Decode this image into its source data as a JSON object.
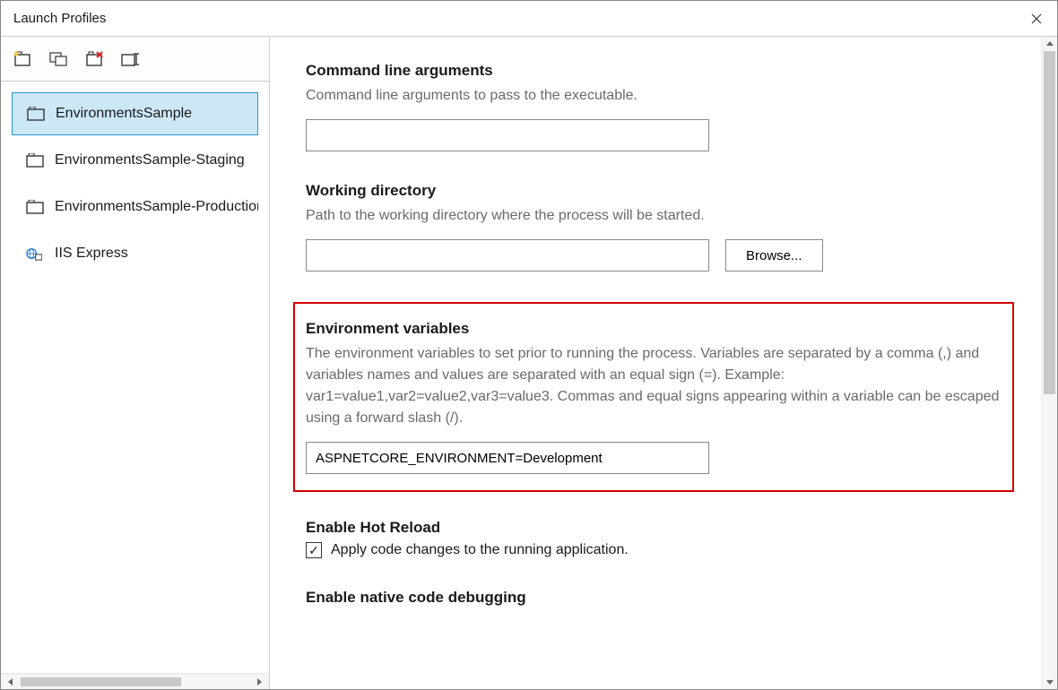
{
  "window": {
    "title": "Launch Profiles"
  },
  "sidebar": {
    "profiles": [
      {
        "label": "EnvironmentsSample",
        "kind": "project",
        "selected": true
      },
      {
        "label": "EnvironmentsSample-Staging",
        "kind": "project",
        "selected": false
      },
      {
        "label": "EnvironmentsSample-Production",
        "kind": "project",
        "selected": false
      },
      {
        "label": "IIS Express",
        "kind": "iis",
        "selected": false
      }
    ]
  },
  "sections": {
    "cmdline": {
      "title": "Command line arguments",
      "desc": "Command line arguments to pass to the executable.",
      "value": ""
    },
    "workingdir": {
      "title": "Working directory",
      "desc": "Path to the working directory where the process will be started.",
      "value": "",
      "browse_label": "Browse..."
    },
    "envvars": {
      "title": "Environment variables",
      "desc": "The environment variables to set prior to running the process. Variables are separated by a comma (,) and variables names and values are separated with an equal sign (=). Example: var1=value1,var2=value2,var3=value3. Commas and equal signs appearing within a variable can be escaped using a forward slash (/).",
      "value": "ASPNETCORE_ENVIRONMENT=Development"
    },
    "hotreload": {
      "title": "Enable Hot Reload",
      "checkbox_label": "Apply code changes to the running application.",
      "checked": true
    },
    "nativedebug": {
      "title": "Enable native code debugging"
    }
  }
}
